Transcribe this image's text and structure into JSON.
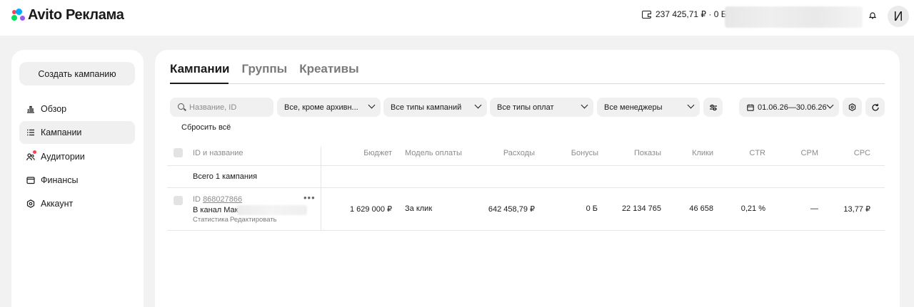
{
  "header": {
    "logo_text": "Avito Реклама",
    "balance": "237 425,71 ₽ · 0 Б",
    "avatar_initial": "И"
  },
  "sidebar": {
    "create_button": "Создать кампанию",
    "items": [
      {
        "label": "Обзор",
        "icon": "bar-chart-icon"
      },
      {
        "label": "Кампании",
        "icon": "list-icon",
        "active": true
      },
      {
        "label": "Аудитории",
        "icon": "users-icon",
        "badge": true
      },
      {
        "label": "Финансы",
        "icon": "wallet-icon"
      },
      {
        "label": "Аккаунт",
        "icon": "gear-icon"
      }
    ]
  },
  "main": {
    "tabs": [
      "Кампании",
      "Группы",
      "Креативы"
    ],
    "active_tab": 0,
    "filters": {
      "search_placeholder": "Название, ID",
      "status": "Все, кроме архивн...",
      "campaign_types": "Все типы кампаний",
      "payment_types": "Все типы оплат",
      "managers": "Все менеджеры",
      "date_range": "01.06.26—30.06.26"
    },
    "reset_label": "Сбросить всё",
    "table": {
      "headers": {
        "id_name": "ID и название",
        "budget": "Бюджет",
        "payment_model": "Модель оплаты",
        "spend": "Расходы",
        "bonuses": "Бонусы",
        "impressions": "Показы",
        "clicks": "Клики",
        "ctr": "CTR",
        "cpm": "CPM",
        "cpc": "CPC"
      },
      "total_label": "Всего 1 кампания",
      "rows": [
        {
          "id_prefix": "ID",
          "id": "868027866",
          "name": "В канал Макс",
          "link_stats": "Статистика",
          "link_edit": "Редактировать",
          "budget": "1 629 000 ₽",
          "payment_model": "За клик",
          "spend": "642 458,79 ₽",
          "bonuses": "0 Б",
          "impressions": "22 134 765",
          "clicks": "46 658",
          "ctr": "0,21 %",
          "cpm": "—",
          "cpc": "13,77 ₽"
        }
      ]
    }
  },
  "colors": {
    "background": "#f2f2f2",
    "panel": "#ffffff",
    "control": "#f0f0f0",
    "muted_text": "#8c8c8c",
    "badge": "#ff4053"
  }
}
